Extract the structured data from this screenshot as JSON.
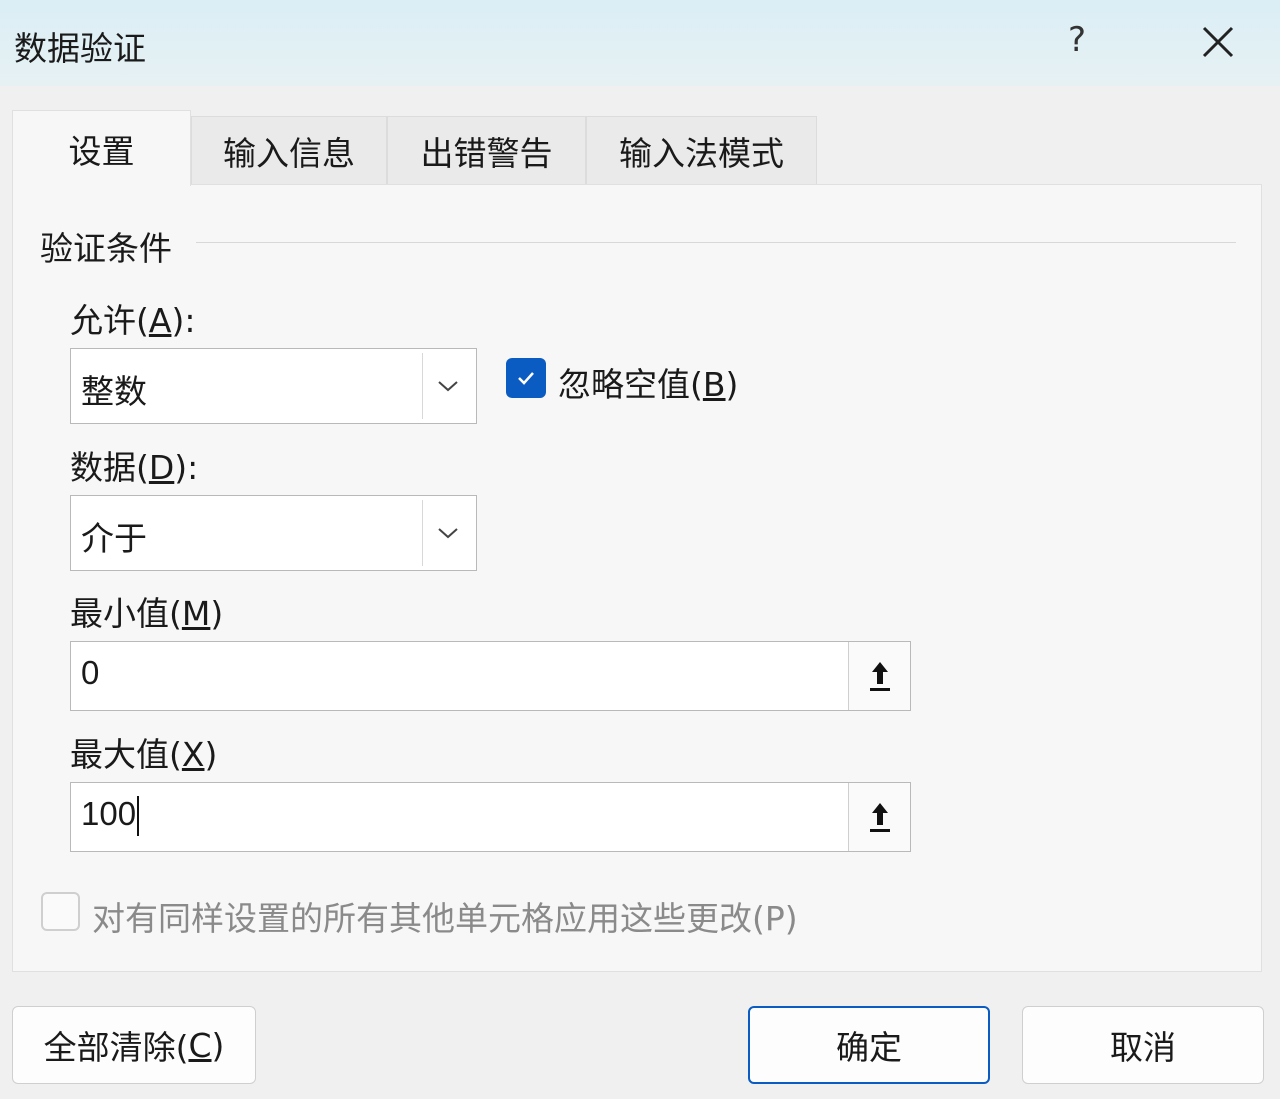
{
  "window": {
    "title": "数据验证"
  },
  "title_buttons": {
    "help": "?"
  },
  "tabs": [
    {
      "label": "设置"
    },
    {
      "label": "输入信息"
    },
    {
      "label": "出错警告"
    },
    {
      "label": "输入法模式"
    }
  ],
  "settings": {
    "group_title": "验证条件",
    "allow": {
      "label": "允许",
      "mnemonic": "A",
      "suffix": "):",
      "value": "整数"
    },
    "ignore_blank": {
      "label": "忽略空值(",
      "mnemonic": "B",
      "suffix": ")",
      "checked": true
    },
    "data": {
      "label": "数据(",
      "mnemonic": "D",
      "suffix": "):",
      "value": "介于"
    },
    "minimum": {
      "label": "最小值(",
      "mnemonic": "M",
      "suffix": ")",
      "value": "0"
    },
    "maximum": {
      "label": "最大值(",
      "mnemonic": "X",
      "suffix": ")",
      "value": "100"
    },
    "apply_all": {
      "label": "对有同样设置的所有其他单元格应用这些更改(P)",
      "checked": false
    }
  },
  "buttons": {
    "clear_all": {
      "label": "全部清除(",
      "mnemonic": "C",
      "suffix": ")"
    },
    "ok": "确定",
    "cancel": "取消"
  },
  "colors": {
    "accent": "#0a5cc2",
    "titlebar": "#dbeef5"
  }
}
